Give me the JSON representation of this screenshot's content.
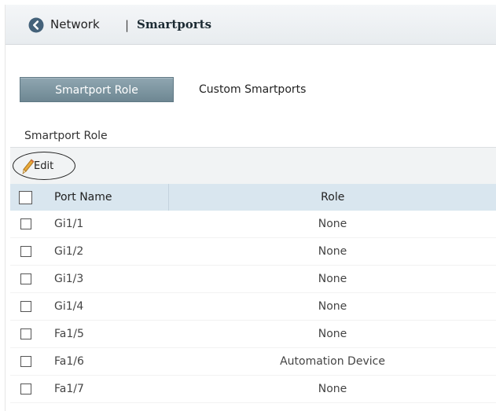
{
  "header": {
    "breadcrumb_parent": "Network",
    "separator": "|",
    "title": "Smartports"
  },
  "tabs": [
    {
      "label": "Smartport Role",
      "active": true
    },
    {
      "label": "Custom Smartports",
      "active": false
    }
  ],
  "section_title": "Smartport Role",
  "toolbar": {
    "edit_label": "Edit"
  },
  "table": {
    "columns": [
      "Port Name",
      "Role"
    ],
    "rows": [
      {
        "port": "Gi1/1",
        "role": "None"
      },
      {
        "port": "Gi1/2",
        "role": "None"
      },
      {
        "port": "Gi1/3",
        "role": "None"
      },
      {
        "port": "Gi1/4",
        "role": "None"
      },
      {
        "port": "Fa1/5",
        "role": "None"
      },
      {
        "port": "Fa1/6",
        "role": "Automation Device"
      },
      {
        "port": "Fa1/7",
        "role": "None"
      }
    ]
  },
  "colors": {
    "header_bg": "#e8ecef",
    "active_tab": "#7b939f",
    "table_header": "#d9e6ef",
    "back_icon": "#44627a"
  },
  "icons": {
    "back": "chevron-left-circle-icon",
    "edit": "pencil-icon"
  }
}
